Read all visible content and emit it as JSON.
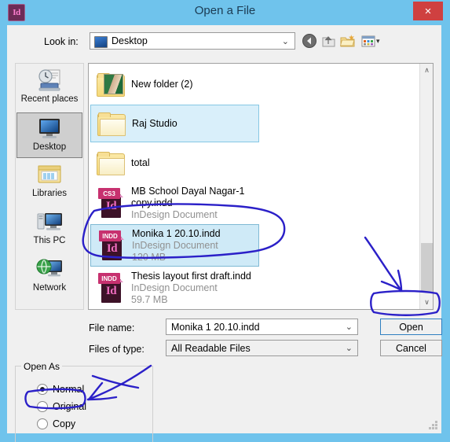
{
  "window": {
    "title": "Open a File",
    "app_icon": "indesign-id-icon",
    "close_label": "×",
    "accent_titlebar": "#6fc3ec",
    "close_color": "#cf4040"
  },
  "toolbar": {
    "lookin_label": "Look in:",
    "lookin_value": "Desktop",
    "lookin_icon": "desktop-icon",
    "dropdown_arrow": "⌄",
    "icons": [
      {
        "name": "back-icon",
        "glyph": "◀"
      },
      {
        "name": "up-one-level-icon",
        "glyph": "↑"
      },
      {
        "name": "new-folder-icon",
        "glyph": "⊕"
      },
      {
        "name": "views-icon",
        "glyph": "▦"
      }
    ],
    "views_arrow": "▾"
  },
  "places": {
    "items": [
      {
        "label": "Recent places",
        "icon": "recent-places-icon",
        "selected": false
      },
      {
        "label": "Desktop",
        "icon": "desktop-icon",
        "selected": true
      },
      {
        "label": "Libraries",
        "icon": "libraries-icon",
        "selected": false
      },
      {
        "label": "This PC",
        "icon": "this-pc-icon",
        "selected": false
      },
      {
        "label": "Network",
        "icon": "network-icon",
        "selected": false
      }
    ]
  },
  "file_list": {
    "rows": [
      {
        "name": "New folder (2)",
        "type": "",
        "size": "",
        "icon": "folder-photo-icon",
        "state": "none"
      },
      {
        "name": "Raj Studio",
        "type": "",
        "size": "",
        "icon": "folder-icon",
        "state": "hover"
      },
      {
        "name": "total",
        "type": "",
        "size": "",
        "icon": "folder-icon",
        "state": "none"
      },
      {
        "name": "MB School Dayal Nagar-1 copy.indd",
        "type": "InDesign Document",
        "size": "",
        "icon": "indesign-document-icon",
        "badge": "CS3",
        "state": "none"
      },
      {
        "name": "Monika 1 20.10.indd",
        "type": "InDesign Document",
        "size": "120 MB",
        "icon": "indesign-document-icon",
        "badge": "INDD",
        "state": "selected"
      },
      {
        "name": "Thesis layout first draft.indd",
        "type": "InDesign Document",
        "size": "59.7 MB",
        "icon": "indesign-document-icon",
        "badge": "INDD",
        "state": "none"
      }
    ],
    "scrollbar": {
      "up_arrow": "∧",
      "down_arrow": "∨"
    }
  },
  "form": {
    "filename_label": "File name:",
    "filename_value": "Monika 1 20.10.indd",
    "filetype_label": "Files of type:",
    "filetype_value": "All Readable Files",
    "dropdown_arrow": "⌄",
    "open_label": "Open",
    "cancel_label": "Cancel"
  },
  "open_as": {
    "legend": "Open As",
    "options": [
      {
        "label": "Normal",
        "selected": true
      },
      {
        "label": "Original",
        "selected": false
      },
      {
        "label": "Copy",
        "selected": false
      }
    ]
  },
  "annotations": {
    "ink_color": "#2b20c8",
    "marks": [
      {
        "name": "circle-selected-file",
        "shape": "ellipse"
      },
      {
        "name": "arrow-to-open-button",
        "shape": "arrow"
      },
      {
        "name": "circle-open-button",
        "shape": "rounded-rect"
      },
      {
        "name": "arrow-to-copy-option",
        "shape": "arrow"
      },
      {
        "name": "circle-copy-option",
        "shape": "rounded-rect"
      }
    ]
  }
}
